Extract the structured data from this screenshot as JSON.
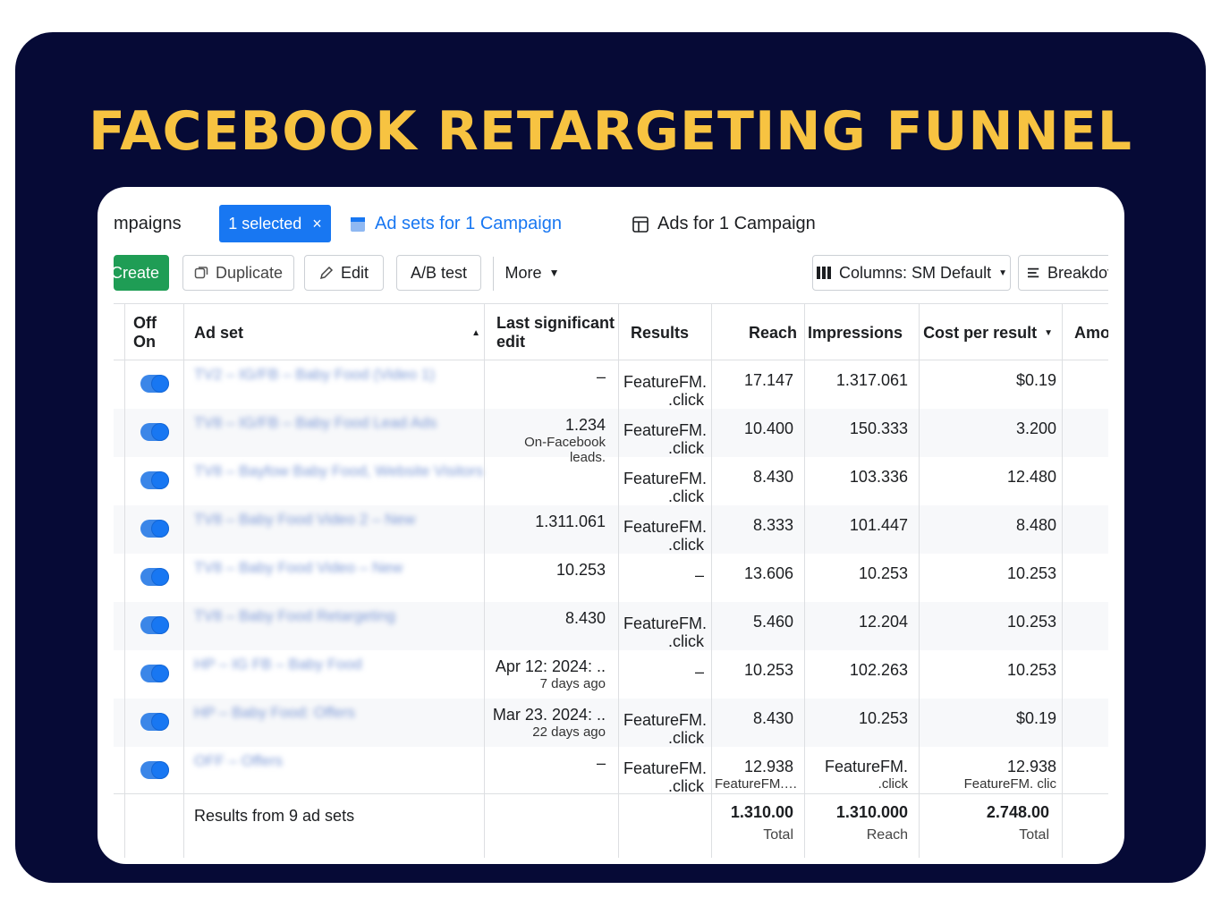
{
  "headline": "FACEBOOK RETARGETING FUNNEL",
  "tabs": {
    "campaigns": "mpaigns",
    "selected": "1 selected",
    "close": "×",
    "adsets": "Ad sets for 1 Campaign",
    "ads": "Ads for 1 Campaign"
  },
  "toolbar": {
    "create": "Create",
    "duplicate": "Duplicate",
    "edit": "Edit",
    "ab_test": "A/B test",
    "more": "More",
    "columns": "Columns: SM Default",
    "breakdown": "Breakdov"
  },
  "headers": {
    "off": "Off",
    "on": "On",
    "ad_set": "Ad set",
    "last_edit_1": "Last significant",
    "last_edit_2": "edit",
    "results": "Results",
    "reach": "Reach",
    "impressions": "Impressions",
    "cost": "Cost per result",
    "amount": "Amo"
  },
  "rows": [
    {
      "name": "TV2 – IG/FB – Baby Food (Video 1)",
      "edit": "–",
      "edit_sub": "",
      "res1": "FeatureFM.",
      "res2": ".click",
      "reach": "17.147",
      "reach_sub": "",
      "impr": "1.317.061",
      "impr_sub": "",
      "cost": "$0.19",
      "cost_sub": ""
    },
    {
      "name": "TV8 – IG/FB – Baby Food Lead Ads",
      "edit": "1.234",
      "edit_sub": "On-Facebook leads.",
      "res1": "FeatureFM.",
      "res2": ".click",
      "reach": "10.400",
      "reach_sub": "",
      "impr": "150.333",
      "impr_sub": "",
      "cost": "3.200",
      "cost_sub": ""
    },
    {
      "name": "TV8 – Bayfow Baby Food, Website Visitors",
      "edit": "",
      "edit_sub": "",
      "res1": "FeatureFM.",
      "res2": ".click",
      "reach": "8.430",
      "reach_sub": "",
      "impr": "103.336",
      "impr_sub": "",
      "cost": "12.480",
      "cost_sub": ""
    },
    {
      "name": "TV8 – Baby Food Video 2 – New",
      "edit": "1.311.061",
      "edit_sub": "",
      "res1": "FeatureFM.",
      "res2": ".click",
      "reach": "8.333",
      "reach_sub": "",
      "impr": "101.447",
      "impr_sub": "",
      "cost": "8.480",
      "cost_sub": ""
    },
    {
      "name": "TV8 – Baby Food Video – New",
      "edit": "10.253",
      "edit_sub": "",
      "res1": "–",
      "res2": "",
      "reach": "13.606",
      "reach_sub": "",
      "impr": "10.253",
      "impr_sub": "",
      "cost": "10.253",
      "cost_sub": ""
    },
    {
      "name": "TV8 – Baby Food Retargeting",
      "edit": "8.430",
      "edit_sub": "",
      "res1": "FeatureFM.",
      "res2": ".click",
      "reach": "5.460",
      "reach_sub": "",
      "impr": "12.204",
      "impr_sub": "",
      "cost": "10.253",
      "cost_sub": ""
    },
    {
      "name": "HP – IG FB – Baby Food",
      "edit": "Apr 12: 2024: ..",
      "edit_sub": "7 days ago",
      "res1": "–",
      "res2": "",
      "reach": "10.253",
      "reach_sub": "",
      "impr": "102.263",
      "impr_sub": "",
      "cost": "10.253",
      "cost_sub": ""
    },
    {
      "name": "HP – Baby Food: Offers",
      "edit": "Mar 23. 2024: ..",
      "edit_sub": "22 days ago",
      "res1": "FeatureFM.",
      "res2": ".click",
      "reach": "8.430",
      "reach_sub": "",
      "impr": "10.253",
      "impr_sub": "",
      "cost": "$0.19",
      "cost_sub": ""
    },
    {
      "name": "OFF – Offers",
      "edit": "–",
      "edit_sub": "",
      "res1": "FeatureFM.",
      "res2": ".click",
      "reach": "12.938",
      "reach_sub": "FeatureFM.…",
      "impr": "FeatureFM.",
      "impr_sub": ".click",
      "cost": "12.938",
      "cost_sub": "FeatureFM. clic"
    }
  ],
  "footer": {
    "label": "Results from 9 ad sets",
    "reach_value": "1.310.00",
    "reach_label": "Total",
    "impr_value": "1.310.000",
    "impr_label": "Reach",
    "cost_value": "2.748.00",
    "cost_label": "Total"
  }
}
